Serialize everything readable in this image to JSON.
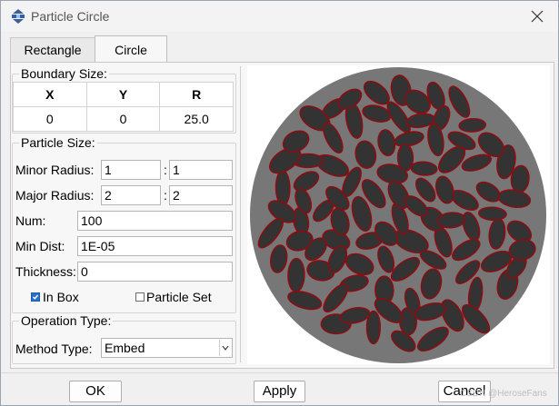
{
  "window": {
    "title": "Particle Circle"
  },
  "tabs": [
    {
      "label": "Rectangle",
      "active": false
    },
    {
      "label": "Circle",
      "active": true
    }
  ],
  "boundary": {
    "legend": "Boundary Size:",
    "headers": [
      "X",
      "Y",
      "R"
    ],
    "values": [
      "0",
      "0",
      "25.0"
    ]
  },
  "particle": {
    "legend": "Particle Size:",
    "minor_label": "Minor Radius:",
    "minor_min": "1",
    "minor_max": "1",
    "major_label": "Major Radius:",
    "major_min": "2",
    "major_max": "2",
    "num_label": "Num:",
    "num": "100",
    "mindist_label": "Min Dist:",
    "mindist": "1E-05",
    "thickness_label": "Thickness:",
    "thickness": "0",
    "inbox_label": "In Box",
    "inbox_checked": true,
    "particleset_label": "Particle Set",
    "particleset_checked": false
  },
  "operation": {
    "legend": "Operation Type:",
    "method_label": "Method Type:",
    "method": "Embed"
  },
  "buttons": {
    "ok": "OK",
    "apply": "Apply",
    "cancel": "Cancel"
  },
  "watermark": "CSDN @HeroseFans",
  "icons": {
    "app": "app-icon",
    "close": "close-icon",
    "dropdown": "chevron-down-icon"
  },
  "colors": {
    "circle_fill": "#777777",
    "particle_fill": "#333333",
    "particle_stroke": "#8a0d12",
    "checkbox_on": "#2770c9"
  }
}
